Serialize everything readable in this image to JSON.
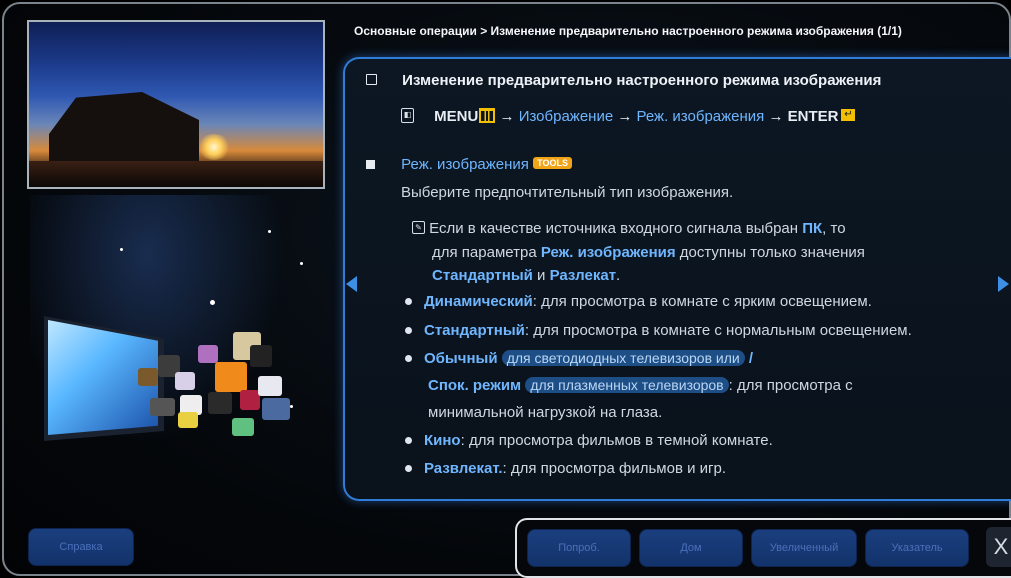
{
  "breadcrumb": "Основные операции > Изменение предварительно настроенного режима изображения (1/1)",
  "section_title": "Изменение предварительно настроенного режима изображения",
  "menu_path": {
    "menu": "MENU",
    "arrow": "→",
    "item1": "Изображение",
    "item2": "Реж. изображения",
    "enter": "ENTER"
  },
  "subsection": {
    "title": "Реж. изображения",
    "tools_badge": "TOOLS",
    "description": "Выберите предпочтительный тип изображения."
  },
  "note": {
    "line1_a": "Если в качестве источника входного сигнала выбран ",
    "line1_hl": "ПК",
    "line1_b": ", то",
    "line2_a": "для параметра ",
    "line2_hl": "Реж. изображения",
    "line2_b": " доступны только значения",
    "line3_hl1": "Стандартный",
    "line3_mid": " и ",
    "line3_hl2": "Разлекат",
    "line3_end": "."
  },
  "bullets": [
    {
      "name": "Динамический",
      "text": ": для просмотра в комнате с ярким освещением."
    },
    {
      "name": "Стандартный",
      "text": ": для просмотра в комнате с нормальным освещением."
    },
    {
      "name": "Обычный",
      "pill": "для светодиодных телевизоров или",
      "slash": " /"
    },
    {
      "name": "Спок. режим",
      "pill": "для плазменных телевизоров",
      "text": ": для просмотра с"
    },
    {
      "text": "минимальной нагрузкой на глаза."
    },
    {
      "name": "Кино",
      "text": ": для просмотра фильмов в темной комнате."
    },
    {
      "name": "Развлекат.",
      "text": ": для просмотра фильмов и игр."
    }
  ],
  "buttons": {
    "help": "Справка",
    "try": "Попроб.",
    "home": "Дом",
    "zoom": "Увеличенный",
    "index": "Указатель",
    "close": "X"
  }
}
